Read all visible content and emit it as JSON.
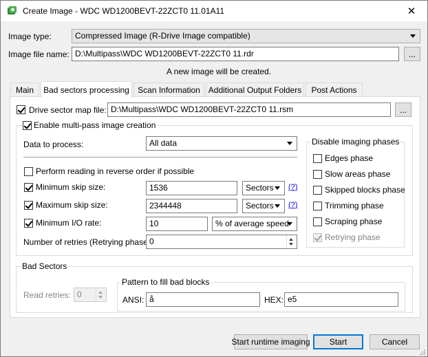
{
  "window": {
    "title": "Create Image - WDC WD1200BEVT-22ZCT0 11.01A11",
    "close_glyph": "✕"
  },
  "image_type": {
    "label": "Image type:",
    "value": "Compressed Image (R-Drive Image compatible)"
  },
  "image_file": {
    "label": "Image file name:",
    "value": "D:\\Multipass\\WDC WD1200BEVT-22ZCT0 11.rdr",
    "browse_label": "..."
  },
  "status_message": "A new image will be created.",
  "tabs": [
    {
      "label": "Main"
    },
    {
      "label": "Bad sectors processing"
    },
    {
      "label": "Scan Information"
    },
    {
      "label": "Additional Output Folders"
    },
    {
      "label": "Post Actions"
    }
  ],
  "drive_map": {
    "label": "Drive sector map file:",
    "value": "D:\\Multipass\\WDC WD1200BEVT-22ZCT0 11.rsm",
    "browse_label": "..."
  },
  "multipass": {
    "label": "Enable multi-pass image creation",
    "data_to_process_label": "Data to process:",
    "data_to_process_value": "All data",
    "reverse_label": "Perform reading in reverse order if possible",
    "min_skip_label": "Minimum skip size:",
    "min_skip_value": "1536",
    "min_skip_unit": "Sectors",
    "max_skip_label": "Maximum skip size:",
    "max_skip_value": "2344448",
    "max_skip_unit": "Sectors",
    "help_label": "(?)",
    "min_io_label": "Minimum I/O rate:",
    "min_io_value": "10",
    "min_io_unit": "% of average speed",
    "retries_label": "Number of retries (Retrying phase):",
    "retries_value": "0"
  },
  "disable_phases": {
    "title": "Disable imaging phases",
    "items": [
      {
        "label": "Edges phase"
      },
      {
        "label": "Slow areas phase"
      },
      {
        "label": "Skipped blocks phase"
      },
      {
        "label": "Trimming phase"
      },
      {
        "label": "Scraping phase"
      },
      {
        "label": "Retrying phase"
      }
    ]
  },
  "bad_sectors": {
    "title": "Bad Sectors",
    "read_retries_label": "Read retries:",
    "read_retries_value": "0",
    "pattern_title": "Pattern to fill bad blocks",
    "ansi_label": "ANSI:",
    "ansi_value": "å",
    "hex_label": "HEX:",
    "hex_value": "e5"
  },
  "buttons": {
    "runtime": "Start runtime imaging",
    "start": "Start",
    "cancel": "Cancel"
  },
  "colors": {
    "accent": "#0078d7",
    "link": "#0000ee"
  }
}
